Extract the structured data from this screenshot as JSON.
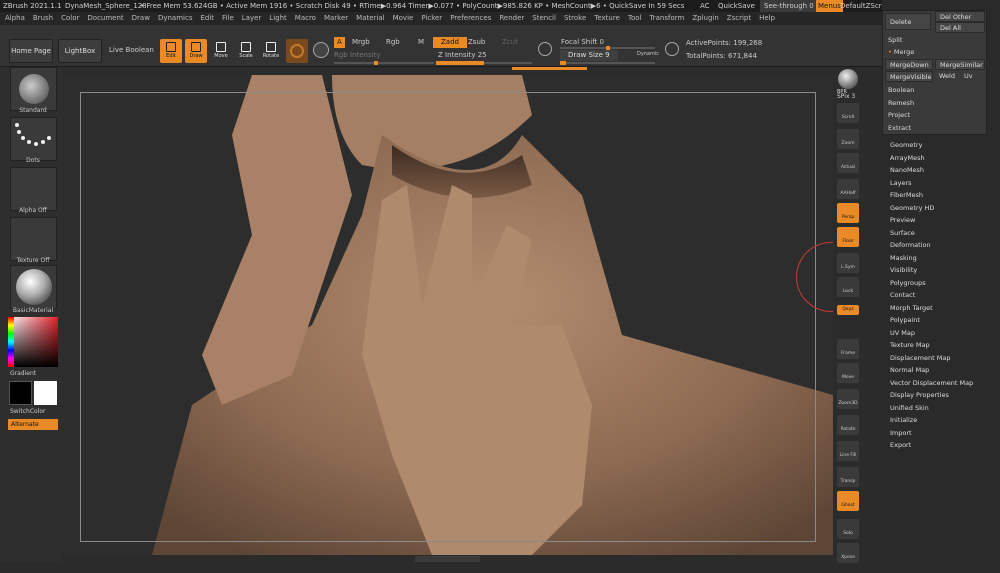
{
  "titlebar": {
    "app": "ZBrush 2021.1.1",
    "project": "DynaMesh_Sphere_128",
    "stats": "• Free Mem 53.624GB • Active Mem 1916 • Scratch Disk 49 • RTime▶0.964 Timer▶0.077 • PolyCount▶985.826 KP • MeshCount▶6 • QuickSave In 59 Secs",
    "ac": "AC",
    "quicksave": "QuickSave",
    "seethrough": "See-through  0",
    "menus": "Menus",
    "script": "DefaultZScript"
  },
  "menubar": [
    "Alpha",
    "Brush",
    "Color",
    "Document",
    "Draw",
    "Dynamics",
    "Edit",
    "File",
    "Layer",
    "Light",
    "Macro",
    "Marker",
    "Material",
    "Movie",
    "Picker",
    "Preferences",
    "Render",
    "Stencil",
    "Stroke",
    "Texture",
    "Tool",
    "Transform",
    "Zplugin",
    "Zscript",
    "Help"
  ],
  "toolbar": {
    "home_page": "Home Page",
    "lightbox": "LightBox",
    "live_boolean": "Live Boolean",
    "tools": [
      {
        "label": "Edit",
        "on": true
      },
      {
        "label": "Draw",
        "on": true
      },
      {
        "label": "Move",
        "on": false
      },
      {
        "label": "Scale",
        "on": false
      },
      {
        "label": "Rotate",
        "on": false
      }
    ],
    "a": "A",
    "mrgb": "Mrgb",
    "rgb": "Rgb",
    "m": "M",
    "rgb_intensity": "Rgb Intensity",
    "zadd": "Zadd",
    "zsub": "Zsub",
    "zcut": "Zcut",
    "z_intensity": "Z Intensity 25",
    "focal_shift": "Focal Shift 0",
    "draw_size": "Draw Size 9",
    "dynamic": "Dynamic",
    "active_points": "ActivePoints: 199,268",
    "total_points": "TotalPoints: 671,844"
  },
  "leftshelf": [
    {
      "label": "Standard"
    },
    {
      "label": "Dots"
    },
    {
      "label": "Alpha Off"
    },
    {
      "label": "Texture Off"
    },
    {
      "label": "BasicMaterial"
    }
  ],
  "colors": {
    "gradient": "Gradient",
    "switch_color": "SwitchColor",
    "alternate": "Alternate",
    "accent": "#e98a27"
  },
  "rightshelf": {
    "bpr": "BPR",
    "spix": "SPix 3",
    "buttons": [
      "Scroll",
      "Zoom",
      "Actual",
      "AAHalf",
      "Persp",
      "Floor",
      "L.Sym",
      "Lock",
      "Qxyz",
      "Frame",
      "Move",
      "Zoom3D",
      "Rotate",
      "Line Fill PolyF",
      "Transp",
      "Ghost",
      "Solo",
      "Xpose"
    ]
  },
  "popup": {
    "delete": "Delete",
    "del_other": "Del Other",
    "del_all": "Del All",
    "split": "Split",
    "merge": "Merge",
    "merge_down": "MergeDown",
    "merge_similar": "MergeSimilar",
    "merge_visible": "MergeVisible",
    "weld": "Weld",
    "uv": "Uv",
    "boolean": "Boolean",
    "remesh": "Remesh",
    "project": "Project",
    "extract": "Extract"
  },
  "tool_list": [
    "Geometry",
    "ArrayMesh",
    "NanoMesh",
    "Layers",
    "FiberMesh",
    "Geometry HD",
    "Preview",
    "Surface",
    "Deformation",
    "Masking",
    "Visibility",
    "Polygroups",
    "Contact",
    "Morph Target",
    "Polypaint",
    "UV Map",
    "Texture Map",
    "Displacement Map",
    "Normal Map",
    "Vector Displacement Map",
    "Display Properties",
    "Unified Skin",
    "Initialize",
    "Import",
    "Export"
  ]
}
